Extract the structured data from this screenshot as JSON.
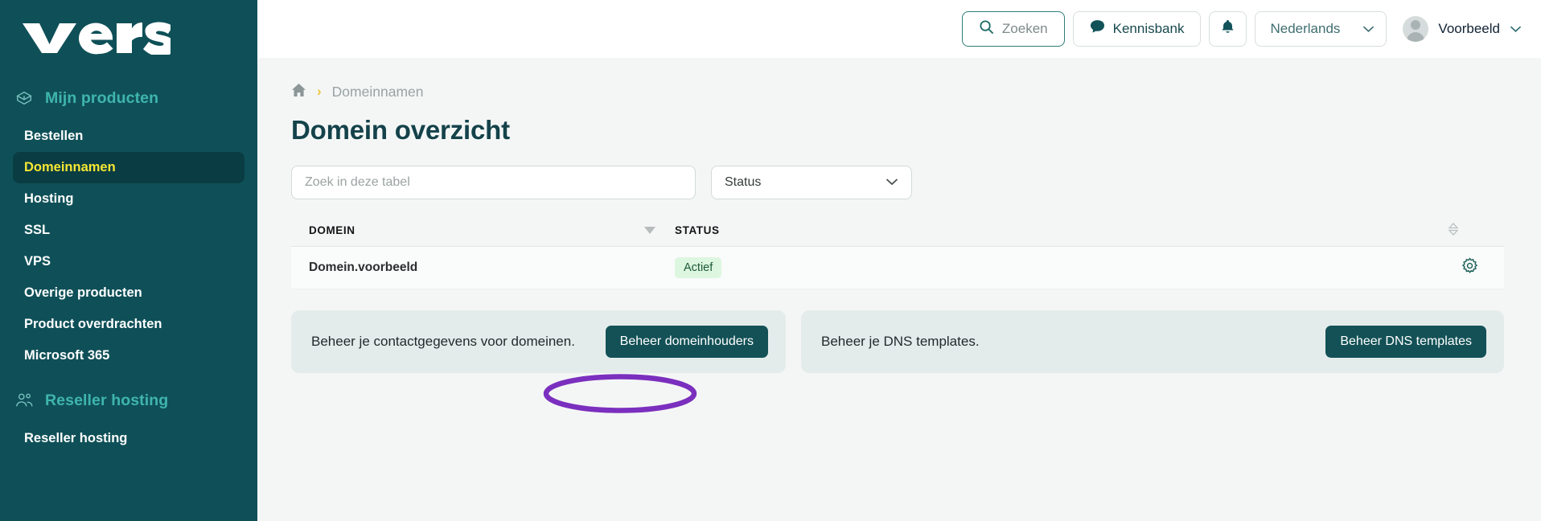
{
  "brand": {
    "logo_text": "versio",
    "sidebar_bg": "#0f5058",
    "accent": "#3fb5ae",
    "active_text": "#f6e733"
  },
  "sidebar": {
    "sections": [
      {
        "icon": "package-icon",
        "label": "Mijn producten",
        "items": [
          {
            "label": "Bestellen",
            "active": false
          },
          {
            "label": "Domeinnamen",
            "active": true
          },
          {
            "label": "Hosting",
            "active": false
          },
          {
            "label": "SSL",
            "active": false
          },
          {
            "label": "VPS",
            "active": false
          },
          {
            "label": "Overige producten",
            "active": false
          },
          {
            "label": "Product overdrachten",
            "active": false
          },
          {
            "label": "Microsoft 365",
            "active": false
          }
        ]
      },
      {
        "icon": "users-icon",
        "label": "Reseller hosting",
        "items": [
          {
            "label": "Reseller hosting",
            "active": false
          }
        ]
      }
    ]
  },
  "topbar": {
    "search_label": "Zoeken",
    "knowledge_label": "Kennisbank",
    "notifications_icon": "bell-icon",
    "language": "Nederlands",
    "user_name": "Voorbeeld"
  },
  "breadcrumb": {
    "home_icon": "home-icon",
    "separator": "›",
    "current": "Domeinnamen"
  },
  "page": {
    "title": "Domein overzicht"
  },
  "filters": {
    "search_placeholder": "Zoek in deze tabel",
    "search_value": "",
    "status_label": "Status"
  },
  "table": {
    "columns": [
      "DOMEIN",
      "STATUS"
    ],
    "rows": [
      {
        "domain": "Domein.voorbeeld",
        "status": "Actief",
        "action_icon": "gear-icon"
      }
    ]
  },
  "annotation": {
    "shape": "ellipse",
    "color": "#7B2FBE",
    "target": "Domein.voorbeeld"
  },
  "cards": [
    {
      "text": "Beheer je contactgegevens voor domeinen.",
      "button": "Beheer domeinhouders"
    },
    {
      "text": "Beheer je DNS templates.",
      "button": "Beheer DNS templates"
    }
  ]
}
